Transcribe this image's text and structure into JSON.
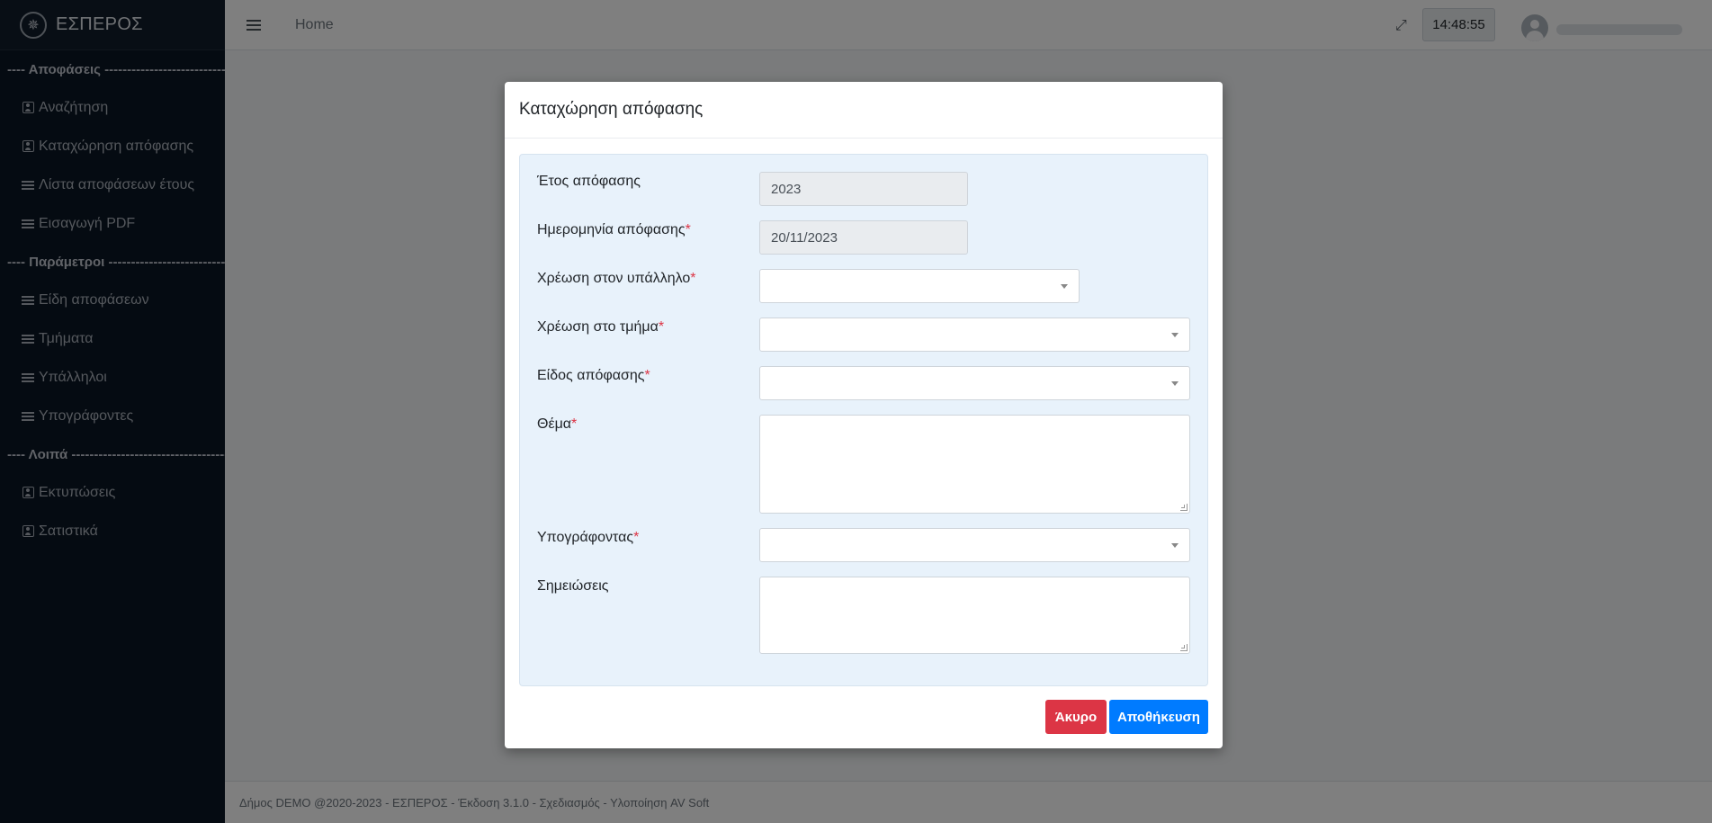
{
  "brand": {
    "name": "ΕΣΠΕΡΟΣ",
    "logo_icon": "compass-icon"
  },
  "sidebar": {
    "sections": [
      {
        "title": "---- Αποφάσεις -----------------------------",
        "items": [
          {
            "label": "Αναζήτηση",
            "icon": "user-card-icon"
          },
          {
            "label": "Καταχώρηση απόφασης",
            "icon": "user-card-icon"
          },
          {
            "label": "Λίστα αποφάσεων έτους",
            "icon": "list-icon"
          },
          {
            "label": "Εισαγωγή PDF",
            "icon": "list-icon"
          }
        ]
      },
      {
        "title": "---- Παράμετροι ------------------------------",
        "items": [
          {
            "label": "Είδη αποφάσεων",
            "icon": "list-icon"
          },
          {
            "label": "Τμήματα",
            "icon": "list-icon"
          },
          {
            "label": "Υπάλληλοι",
            "icon": "list-icon"
          },
          {
            "label": "Υπογράφοντες",
            "icon": "list-icon"
          }
        ]
      },
      {
        "title": "---- Λοιπά -------------------------------------",
        "items": [
          {
            "label": "Εκτυπώσεις",
            "icon": "user-card-icon"
          },
          {
            "label": "Σατιστικά",
            "icon": "user-card-icon"
          }
        ]
      }
    ]
  },
  "header": {
    "home_label": "Home",
    "clock": "14:48:55"
  },
  "footer": {
    "text": "Δήμος DEMO @2020-2023 - ΕΣΠΕΡΟΣ - Έκδοση 3.1.0 - Σχεδιασμός - Υλοποίηση AV Soft"
  },
  "modal": {
    "title": "Καταχώρηση απόφασης",
    "fields": {
      "year": {
        "label": "Έτος απόφασης",
        "value": "2023"
      },
      "date": {
        "label": "Ημερομηνία απόφασης",
        "value": "20/11/2023"
      },
      "employee": {
        "label": "Χρέωση στον υπάλληλο",
        "value": ""
      },
      "department": {
        "label": "Χρέωση στο τμήμα",
        "value": ""
      },
      "type": {
        "label": "Είδος απόφασης",
        "value": ""
      },
      "subject": {
        "label": "Θέμα",
        "value": ""
      },
      "signer": {
        "label": "Υπογράφοντας",
        "value": ""
      },
      "notes": {
        "label": "Σημειώσεις",
        "value": ""
      }
    },
    "required_mark": "*",
    "buttons": {
      "cancel": "Άκυρο",
      "save": "Αποθήκευση"
    }
  },
  "colors": {
    "sidebar_bg": "#0b1724",
    "cancel": "#dc3545",
    "save": "#007bff",
    "form_bg": "#e8f2fb"
  }
}
